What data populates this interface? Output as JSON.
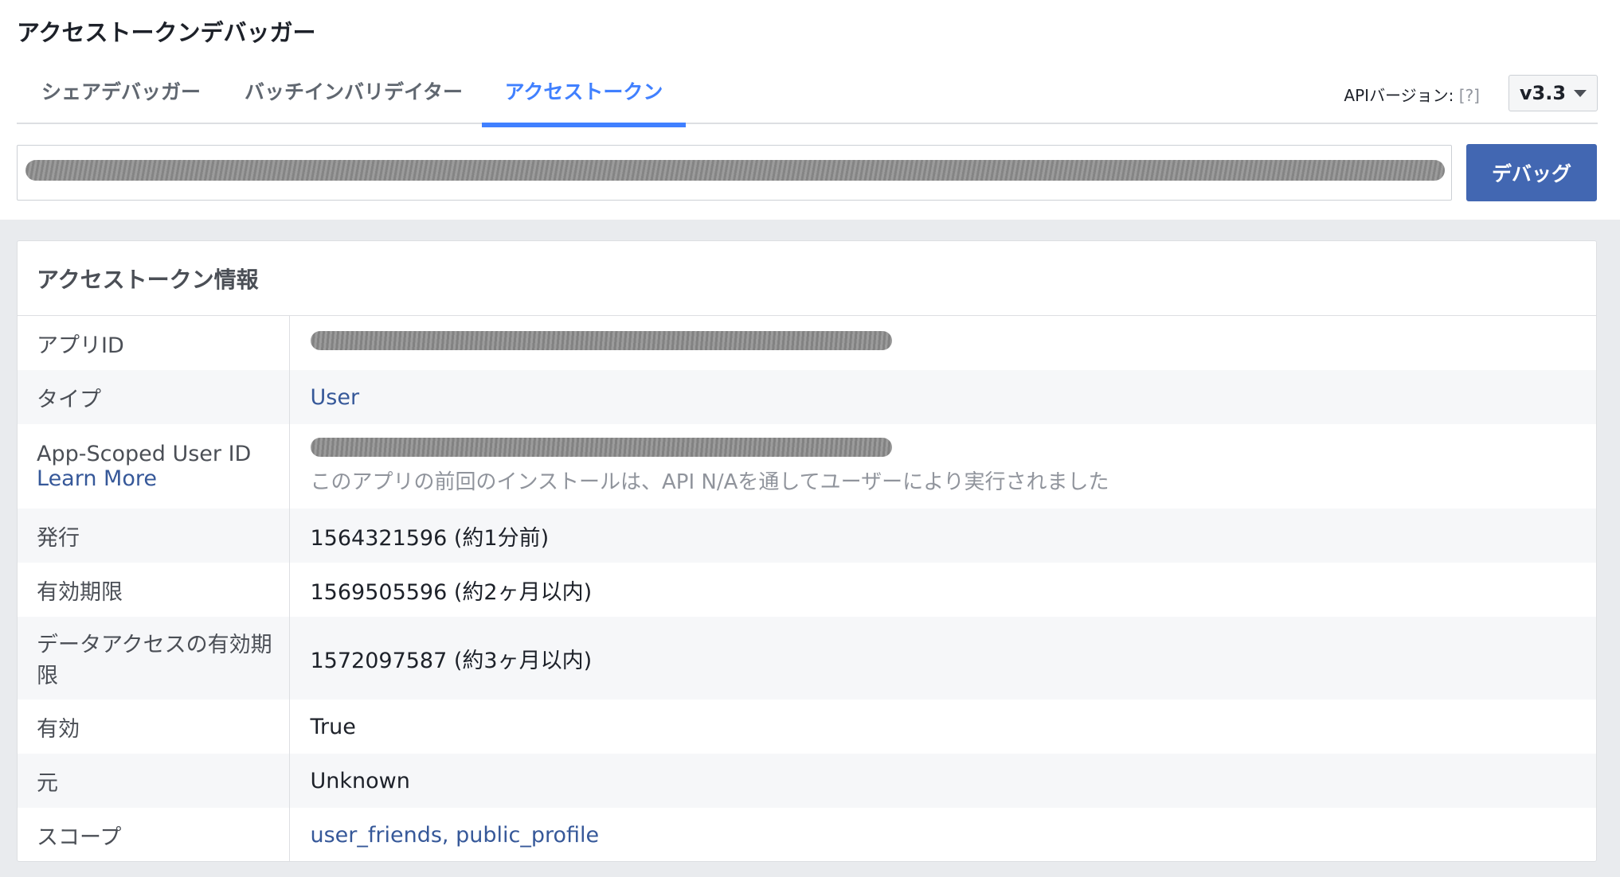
{
  "page_title": "アクセストークンデバッガー",
  "tabs": [
    {
      "label": "シェアデバッガー",
      "active": false
    },
    {
      "label": "バッチインバリデイター",
      "active": false
    },
    {
      "label": "アクセストークン",
      "active": true
    }
  ],
  "api_version": {
    "label": "APIバージョン:",
    "help": "[?]",
    "value": "v3.3"
  },
  "token_input": {
    "value": "(redacted)"
  },
  "debug_button": "デバッグ",
  "panel": {
    "title": "アクセストークン情報",
    "rows": [
      {
        "key": "アプリID",
        "value": "(redacted)"
      },
      {
        "key": "タイプ",
        "value": "User"
      },
      {
        "key": "App-Scoped User ID",
        "key_link": "Learn More",
        "value": "(redacted)",
        "note": "このアプリの前回のインストールは、API N/Aを通してユーザーにより実行されました"
      },
      {
        "key": "発行",
        "value": "1564321596 (約1分前)"
      },
      {
        "key": "有効期限",
        "value": "1569505596 (約2ヶ月以内)"
      },
      {
        "key": "データアクセスの有効期限",
        "value": "1572097587 (約3ヶ月以内)"
      },
      {
        "key": "有効",
        "value": "True"
      },
      {
        "key": "元",
        "value": "Unknown"
      },
      {
        "key": "スコープ",
        "value": "user_friends, public_profile"
      }
    ]
  },
  "colors": {
    "accent": "#4080ff",
    "button": "#4267b2",
    "link": "#365899"
  }
}
